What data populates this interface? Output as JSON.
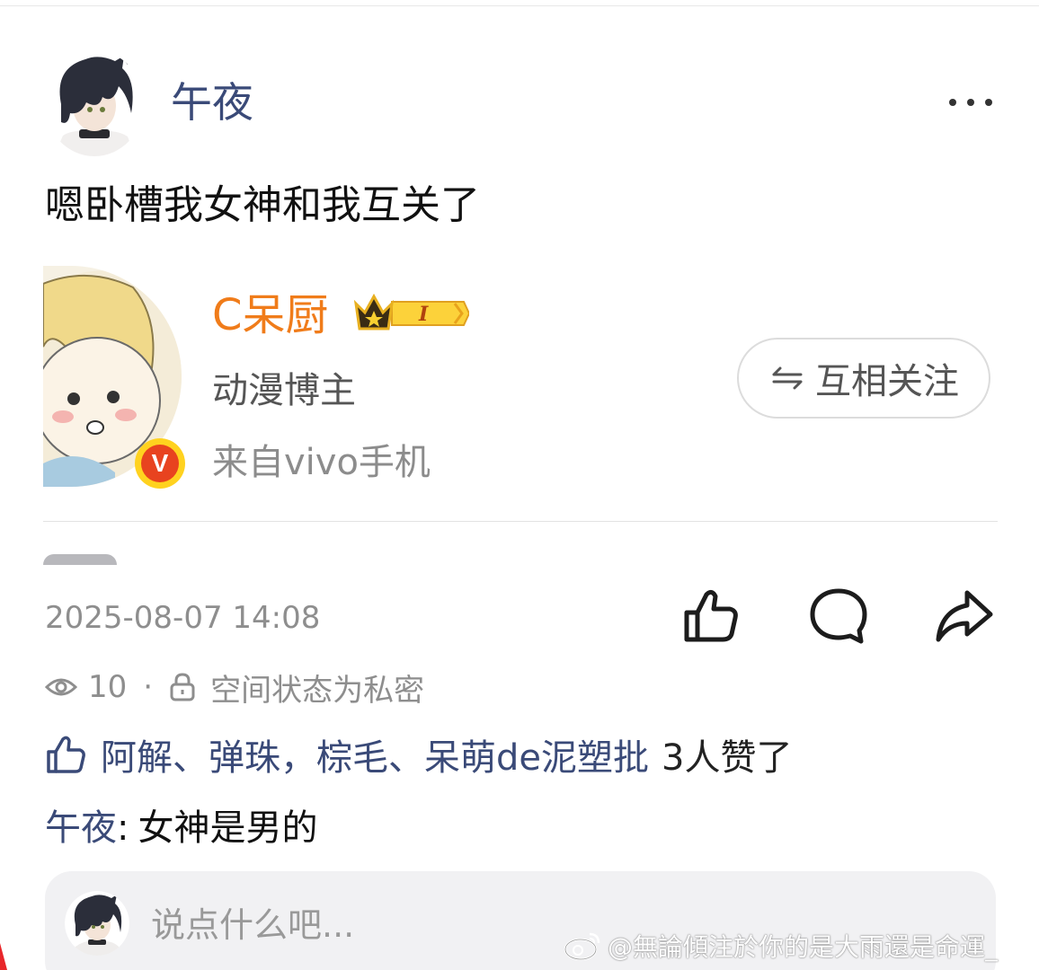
{
  "post": {
    "author": "午夜",
    "text": "嗯卧槽我女神和我互关了",
    "more_icon": "more-horizontal-icon"
  },
  "profile_card": {
    "name": "C呆厨",
    "level_badge": "I",
    "tag": "动漫博主",
    "source": "来自vivo手机",
    "verified_badge": "V",
    "follow_button": "互相关注",
    "name_color": "#f07c1a"
  },
  "meta": {
    "timestamp": "2025-08-07 14:08",
    "views": "10",
    "separator": "·",
    "privacy": "空间状态为私密"
  },
  "actions": [
    "like-icon",
    "comment-icon",
    "share-icon"
  ],
  "likes": {
    "names": "阿解、弹珠，棕毛、呆萌de泥塑批",
    "count_text": "3人赞了"
  },
  "comments": [
    {
      "author": "午夜",
      "separator": ":",
      "text": "女神是男的"
    }
  ],
  "input": {
    "placeholder": "说点什么吧..."
  },
  "watermark": "@無論傾注於你的是大雨還是命運_",
  "colors": {
    "link_blue": "#3a4a78",
    "muted": "#8e8e8e",
    "accent_orange": "#f07c1a"
  }
}
